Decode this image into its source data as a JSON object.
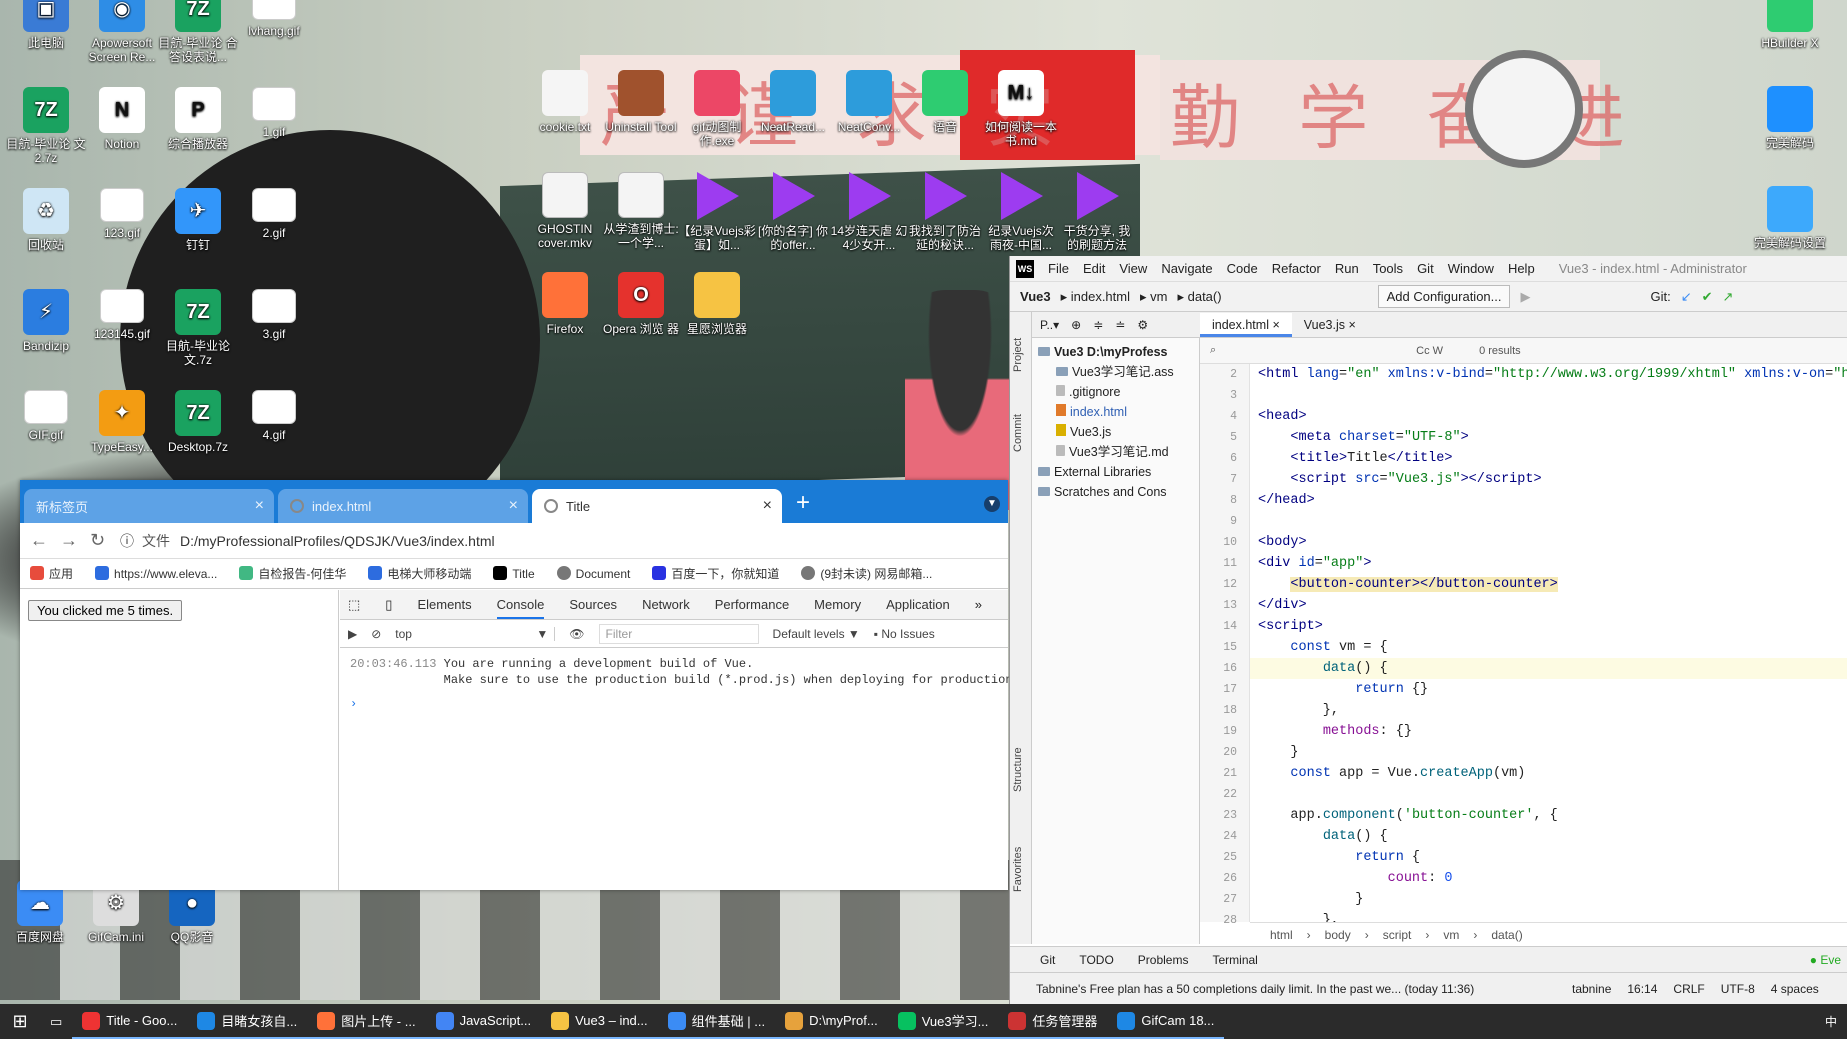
{
  "desktop": {
    "icons": [
      {
        "label": "此电脑",
        "color": "#3a7bd5",
        "glyph": "▣"
      },
      {
        "label": "Apowersoft Screen Re...",
        "color": "#2e8de6",
        "glyph": "◉"
      },
      {
        "label": "目航-毕业论 合答设表说...",
        "color": "#1aa260",
        "glyph": "7Z"
      },
      {
        "label": "lvhang.gif",
        "color": "#fff",
        "glyph": ""
      },
      {
        "label": "目航-毕业论 文2.7z",
        "color": "#1aa260",
        "glyph": "7Z"
      },
      {
        "label": "Notion",
        "color": "#fff",
        "glyph": "N"
      },
      {
        "label": "综合播放器",
        "color": "#fff",
        "glyph": "P"
      },
      {
        "label": "1.gif",
        "color": "#fff",
        "glyph": ""
      },
      {
        "label": "回收站",
        "color": "#cfe6f5",
        "glyph": "♻"
      },
      {
        "label": "123.gif",
        "color": "#fff",
        "glyph": ""
      },
      {
        "label": "钉钉",
        "color": "#3296fa",
        "glyph": "✈"
      },
      {
        "label": "2.gif",
        "color": "#fff",
        "glyph": ""
      },
      {
        "label": "Bandizip",
        "color": "#2b7de0",
        "glyph": "⚡"
      },
      {
        "label": "123145.gif",
        "color": "#fff",
        "glyph": ""
      },
      {
        "label": "目航-毕业论 文.7z",
        "color": "#1aa260",
        "glyph": "7Z"
      },
      {
        "label": "3.gif",
        "color": "#fff",
        "glyph": ""
      },
      {
        "label": "GIF.gif",
        "color": "#fff",
        "glyph": ""
      },
      {
        "label": "TypeEasy...",
        "color": "#f39c12",
        "glyph": "✦"
      },
      {
        "label": "Desktop.7z",
        "color": "#1aa260",
        "glyph": "7Z"
      },
      {
        "label": "4.gif",
        "color": "#fff",
        "glyph": ""
      },
      {
        "label": "百度网盘",
        "color": "#3b8cf5",
        "glyph": "☁"
      },
      {
        "label": "GifCam.ini",
        "color": "#ddd",
        "glyph": "⚙"
      },
      {
        "label": "QQ影音",
        "color": "#1565c0",
        "glyph": "●"
      }
    ],
    "middle": [
      {
        "label": "cookie.txt"
      },
      {
        "label": "Uninstall Tool"
      },
      {
        "label": "gif动图制作.exe"
      },
      {
        "label": "NeatRead..."
      },
      {
        "label": "NeatConv..."
      },
      {
        "label": "语音"
      },
      {
        "label": "如何阅读一本书.md"
      }
    ],
    "media": [
      {
        "label": "GHOSTIN cover.mkv",
        "type": "MKV"
      },
      {
        "label": "从学渣到博士: 一个学...",
        "type": "MKV"
      },
      {
        "label": "【纪录Vuejs彩蛋】如...",
        "type": "FLV"
      },
      {
        "label": "[你的名字] 你的offer...",
        "type": "FLV"
      },
      {
        "label": "14岁连天虐 幻4少女开...",
        "type": "FLV"
      },
      {
        "label": "我找到了防治 延的秘诀...",
        "type": "FLV"
      },
      {
        "label": "纪录Vuejs次 雨夜-中国...",
        "type": "FLV"
      },
      {
        "label": "干货分享, 我 的刷题方法",
        "type": "FLV"
      }
    ],
    "browsers": [
      {
        "label": "Firefox"
      },
      {
        "label": "Opera 浏览 器"
      },
      {
        "label": "星愿浏览器"
      }
    ],
    "right": [
      {
        "label": "HBuilder X"
      },
      {
        "label": "完美解码"
      },
      {
        "label": "完美解码设置"
      }
    ],
    "banner_left": "严 谨 求 实",
    "banner_right": "勤 学 奋 进"
  },
  "browser": {
    "tabs": [
      {
        "label": "新标签页"
      },
      {
        "label": "index.html"
      },
      {
        "label": "Title"
      }
    ],
    "new_tab": "+",
    "address_prefix": "文件",
    "url": "D:/myProfessionalProfiles/QDSJK/Vue3/index.html",
    "bookmarks": [
      "应用",
      "https://www.eleva...",
      "自检报告-何佳华",
      "电梯大师移动端",
      "Title",
      "Document",
      "百度一下，你就知道",
      "(9封未读) 网易邮箱..."
    ],
    "page_button": "You clicked me 5 times.",
    "devtools": {
      "tabs": [
        "Elements",
        "Console",
        "Sources",
        "Network",
        "Performance",
        "Memory",
        "Application"
      ],
      "active_tab": "Console",
      "context": "top",
      "filter_placeholder": "Filter",
      "levels": "Default levels ▼",
      "issues": "No Issues",
      "log_time": "20:03:46.113",
      "log_line1": "You are running a development build of Vue.",
      "log_line2": "Make sure to use the production build (*.prod.js) when deploying for production."
    }
  },
  "ide": {
    "menu": [
      "File",
      "Edit",
      "View",
      "Navigate",
      "Code",
      "Refactor",
      "Run",
      "Tools",
      "Git",
      "Window",
      "Help"
    ],
    "window_title": "Vue3 - index.html - Administrator",
    "breadcrumb": [
      "Vue3",
      "index.html",
      "vm",
      "data()"
    ],
    "add_config": "Add Configuration...",
    "git_label": "Git:",
    "project_tab": "P..▾",
    "tree": [
      {
        "label": "Vue3  D:\\myProfess",
        "kind": "fold",
        "indent": 0
      },
      {
        "label": "Vue3学习笔记.ass",
        "kind": "fold",
        "indent": 1
      },
      {
        "label": ".gitignore",
        "kind": "file",
        "indent": 1
      },
      {
        "label": "index.html",
        "kind": "htm",
        "indent": 1
      },
      {
        "label": "Vue3.js",
        "kind": "js",
        "indent": 1
      },
      {
        "label": "Vue3学习笔记.md",
        "kind": "file",
        "indent": 1
      },
      {
        "label": "External Libraries",
        "kind": "fold",
        "indent": 0
      },
      {
        "label": "Scratches and Cons",
        "kind": "fold",
        "indent": 0
      }
    ],
    "editor_tabs": [
      {
        "label": "index.html",
        "active": true
      },
      {
        "label": "Vue3.js",
        "active": false
      }
    ],
    "find_results": "0 results",
    "find_opts": "Cc  W",
    "side_labels": [
      "Project",
      "Commit",
      "Structure",
      "Favorites"
    ],
    "code_crumbs": [
      "html",
      "body",
      "script",
      "vm",
      "data()"
    ],
    "bottom_tools": [
      "Git",
      "TODO",
      "Problems",
      "Terminal"
    ],
    "status_msg": "Tabnine's Free plan has a 50 completions daily limit. In the past we... (today 11:36)",
    "status_right": [
      "tabnine",
      "16:14",
      "CRLF",
      "UTF-8",
      "4 spaces"
    ],
    "event_log": "Eve"
  },
  "taskbar": {
    "items": [
      "Title - Goo...",
      "目睹女孩自...",
      "图片上传 - ...",
      "JavaScript...",
      "Vue3 – ind...",
      "组件基础 | ...",
      "D:\\myProf...",
      "Vue3学习...",
      "任务管理器",
      "GifCam 18..."
    ],
    "tray": "中"
  }
}
